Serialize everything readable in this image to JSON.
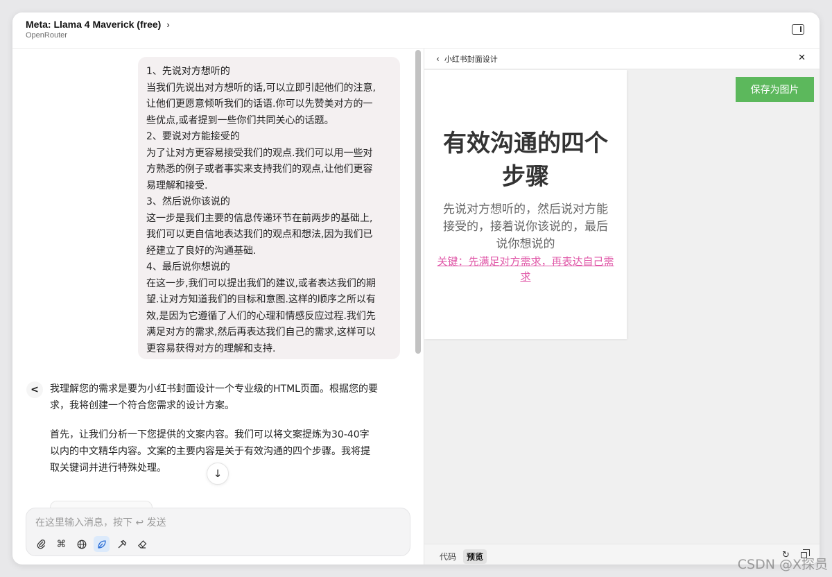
{
  "header": {
    "model_name": "Meta: Llama 4 Maverick (free)",
    "provider": "OpenRouter"
  },
  "user_message": {
    "lines": [
      "1、先说对方想听的",
      "当我们先说出对方想听的话,可以立即引起他们的注意,",
      "让他们更愿意倾听我们的话语.你可以先赞美对方的一",
      "些优点,或者提到一些你们共同关心的话题。",
      "2、要说对方能接受的",
      "为了让对方更容易接受我们的观点.我们可以用一些对",
      "方熟悉的例子或者事实来支持我们的观点,让他们更容",
      "易理解和接受.",
      "3、然后说你该说的",
      "这一步是我们主要的信息传递环节在前两步的基础上,",
      "我们可以更自信地表达我们的观点和想法,因为我们已",
      "经建立了良好的沟通基础.",
      "4、最后说你想说的",
      "在这一步,我们可以提出我们的建议,或者表达我们的期",
      "望.让对方知道我们的目标和意图.这样的顺序之所以有",
      "效,是因为它遵循了人们的心理和情感反应过程.我们先",
      "满足对方的需求,然后再表达我们自己的需求,这样可以",
      "更容易获得对方的理解和支持."
    ]
  },
  "ai_message": {
    "para1_lines": [
      "我理解您的需求是要为小红书封面设计一个专业级的HTML页面。根据您的要",
      "求，我将创建一个符合您需求的设计方案。"
    ],
    "para2_lines": [
      "首先，让我们分析一下您提供的文案内容。我们可以将文案提炼为30-40字",
      "以内的中文精华内容。文案的主要内容是关于有效沟通的四个步骤。我将提",
      "取关键词并进行特殊处理。"
    ]
  },
  "input": {
    "placeholder": "在这里输入消息，按下 ↩ 发送"
  },
  "preview": {
    "back_label": "小红书封面设计",
    "save_label": "保存为图片",
    "cover_title": "有效沟通的四个步骤",
    "cover_desc": "先说对方想听的，然后说对方能接受的，接着说你该说的，最后说你想说的",
    "cover_key": "关键：先满足对方需求，再表达自己需求",
    "tab_code": "代码",
    "tab_preview": "预览"
  },
  "watermark": "CSDN @X探员",
  "colors": {
    "save_button": "#5cb85c",
    "key_highlight": "#e058a8",
    "user_bubble": "#f4f0f1"
  }
}
